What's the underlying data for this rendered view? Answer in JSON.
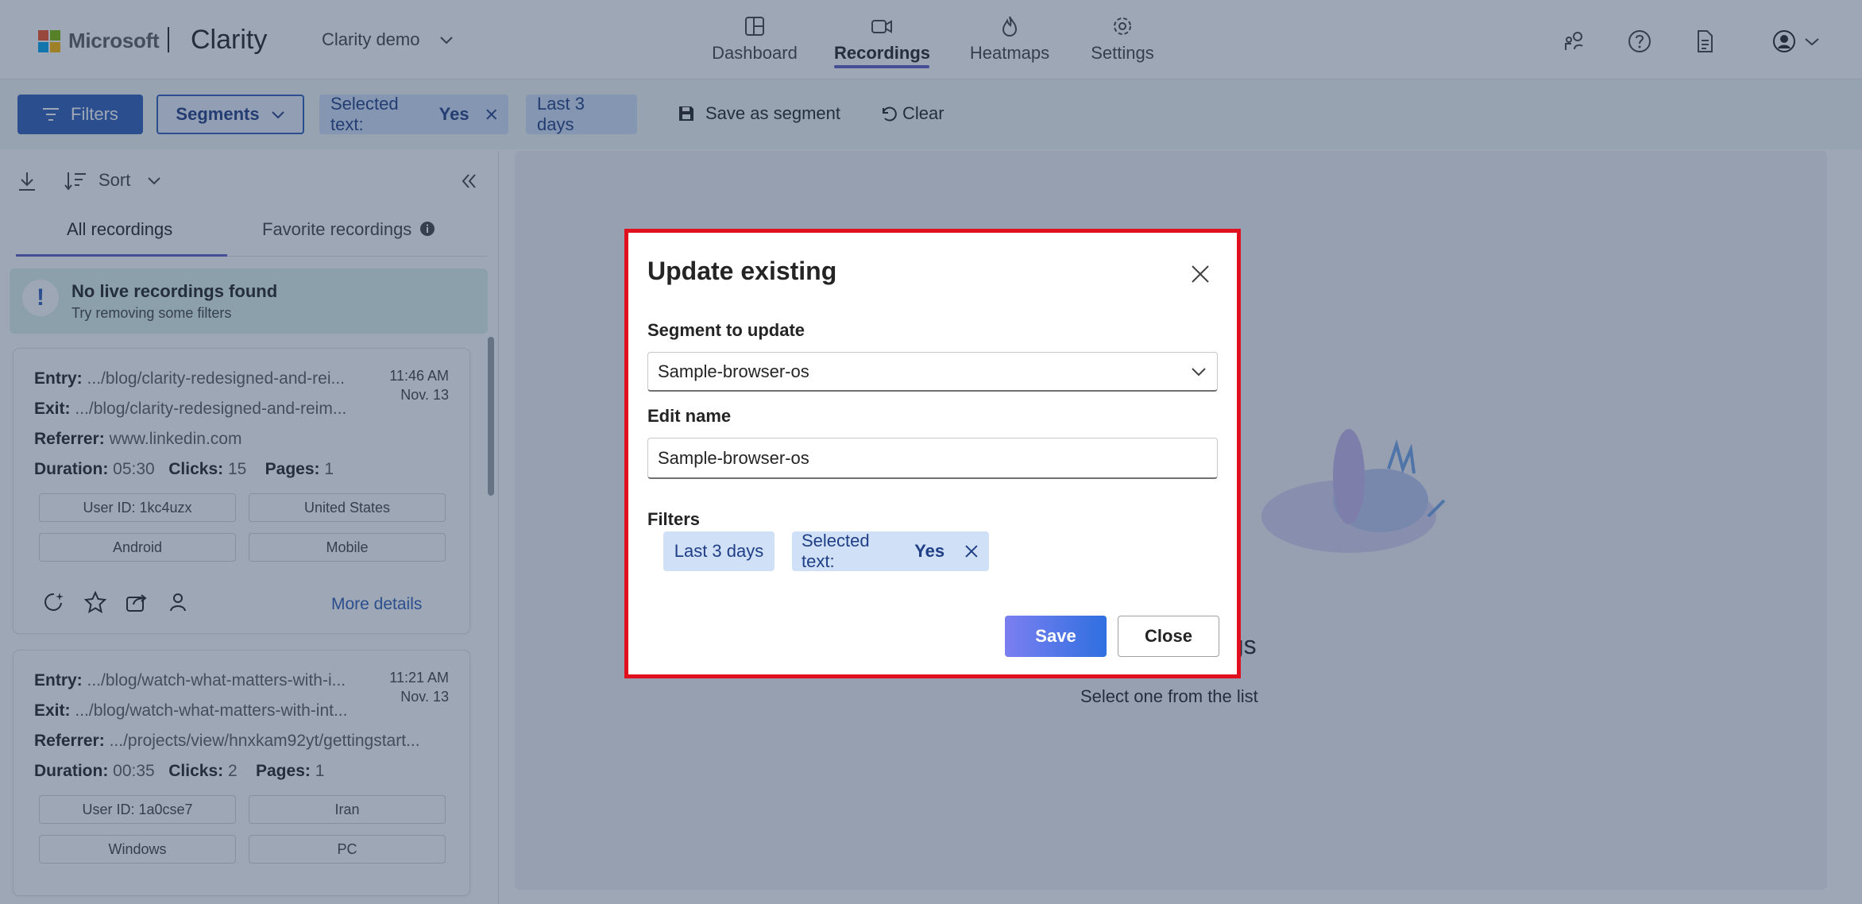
{
  "header": {
    "brand": "Microsoft",
    "app_name": "Clarity",
    "project_name": "Clarity demo",
    "nav": [
      {
        "label": "Dashboard"
      },
      {
        "label": "Recordings"
      },
      {
        "label": "Heatmaps"
      },
      {
        "label": "Settings"
      }
    ]
  },
  "toolbar": {
    "filters_label": "Filters",
    "segments_label": "Segments",
    "chip_selected_text_key": "Selected text:",
    "chip_selected_text_value": "Yes",
    "chip_date": "Last 3 days",
    "save_segment_label": "Save as segment",
    "clear_label": "Clear"
  },
  "left_panel": {
    "sort_label": "Sort",
    "tabs": [
      {
        "label": "All recordings"
      },
      {
        "label": "Favorite recordings"
      }
    ],
    "banner": {
      "title": "No live recordings found",
      "subtitle": "Try removing some filters"
    },
    "recordings": [
      {
        "entry_label": "Entry:",
        "entry": ".../blog/clarity-redesigned-and-rei...",
        "exit_label": "Exit:",
        "exit": ".../blog/clarity-redesigned-and-reim...",
        "referrer_label": "Referrer:",
        "referrer": "www.linkedin.com",
        "duration_label": "Duration:",
        "duration": "05:30",
        "clicks_label": "Clicks:",
        "clicks": "15",
        "pages_label": "Pages:",
        "pages": "1",
        "time": "11:46 AM",
        "date": "Nov. 13",
        "tags": [
          "User ID: 1kc4uzx",
          "United States",
          "Android",
          "Mobile"
        ],
        "more_details": "More details"
      },
      {
        "entry_label": "Entry:",
        "entry": ".../blog/watch-what-matters-with-i...",
        "exit_label": "Exit:",
        "exit": ".../blog/watch-what-matters-with-int...",
        "referrer_label": "Referrer:",
        "referrer": ".../projects/view/hnxkam92yt/gettingstart...",
        "duration_label": "Duration:",
        "duration": "00:35",
        "clicks_label": "Clicks:",
        "clicks": "2",
        "pages_label": "Pages:",
        "pages": "1",
        "time": "11:21 AM",
        "date": "Nov. 13",
        "tags": [
          "User ID: 1a0cse7",
          "Iran",
          "Windows",
          "PC"
        ]
      }
    ]
  },
  "main": {
    "empty_title_partial": "ngs",
    "empty_subtitle": "Select one from the list"
  },
  "dialog": {
    "title": "Update existing",
    "segment_label": "Segment to update",
    "segment_value": "Sample-browser-os",
    "edit_name_label": "Edit name",
    "edit_name_value": "Sample-browser-os",
    "filters_label": "Filters",
    "chip_date": "Last 3 days",
    "chip_selected_text_key": "Selected text:",
    "chip_selected_text_value": "Yes",
    "save_label": "Save",
    "close_label": "Close"
  },
  "colors": {
    "primary": "#2f5db8",
    "accent": "#5b5fc7",
    "chip_bg": "#cfe0f7",
    "dialog_outline": "#e0101e"
  }
}
